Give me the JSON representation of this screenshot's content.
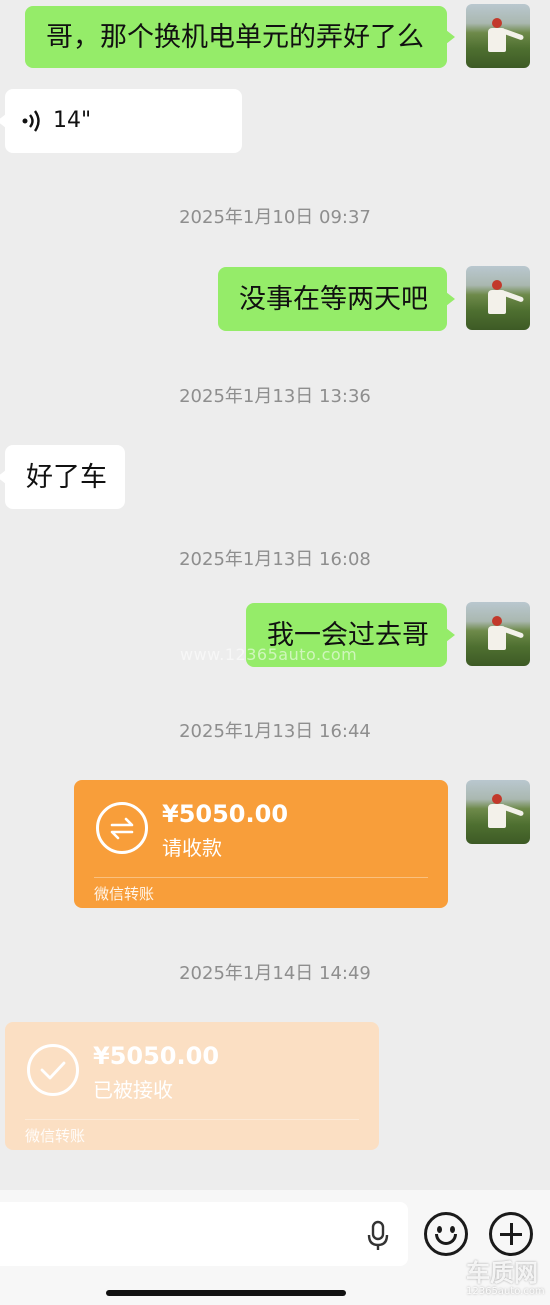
{
  "messages": {
    "m1_text": "哥，那个换机电单元的弄好了么",
    "voice_duration": "14\"",
    "ts1": "2025年1月10日 09:37",
    "m2_text": "没事在等两天吧",
    "ts2": "2025年1月13日 13:36",
    "m3_text": "好了车",
    "ts3": "2025年1月13日 16:08",
    "m4_text": "我一会过去哥",
    "ts4": "2025年1月13日 16:44",
    "ts5": "2025年1月14日 14:49"
  },
  "transfer_sent": {
    "amount": "¥5050.00",
    "status": "请收款",
    "brand": "微信转账",
    "color": "#f89e3a"
  },
  "transfer_received": {
    "amount": "¥5050.00",
    "status": "已被接收",
    "brand": "微信转账",
    "color": "#fbdfc3"
  },
  "watermark": {
    "center_text": "www.12365auto.com",
    "corner_logo": "车质网",
    "corner_url": "12365auto.com"
  },
  "colors": {
    "bubble_mine": "#95ec69",
    "bubble_other": "#ffffff",
    "background": "#ededed"
  },
  "icons": [
    "voice-icon",
    "transfer-arrows-icon",
    "check-icon",
    "microphone-icon",
    "emoji-icon",
    "plus-icon"
  ]
}
